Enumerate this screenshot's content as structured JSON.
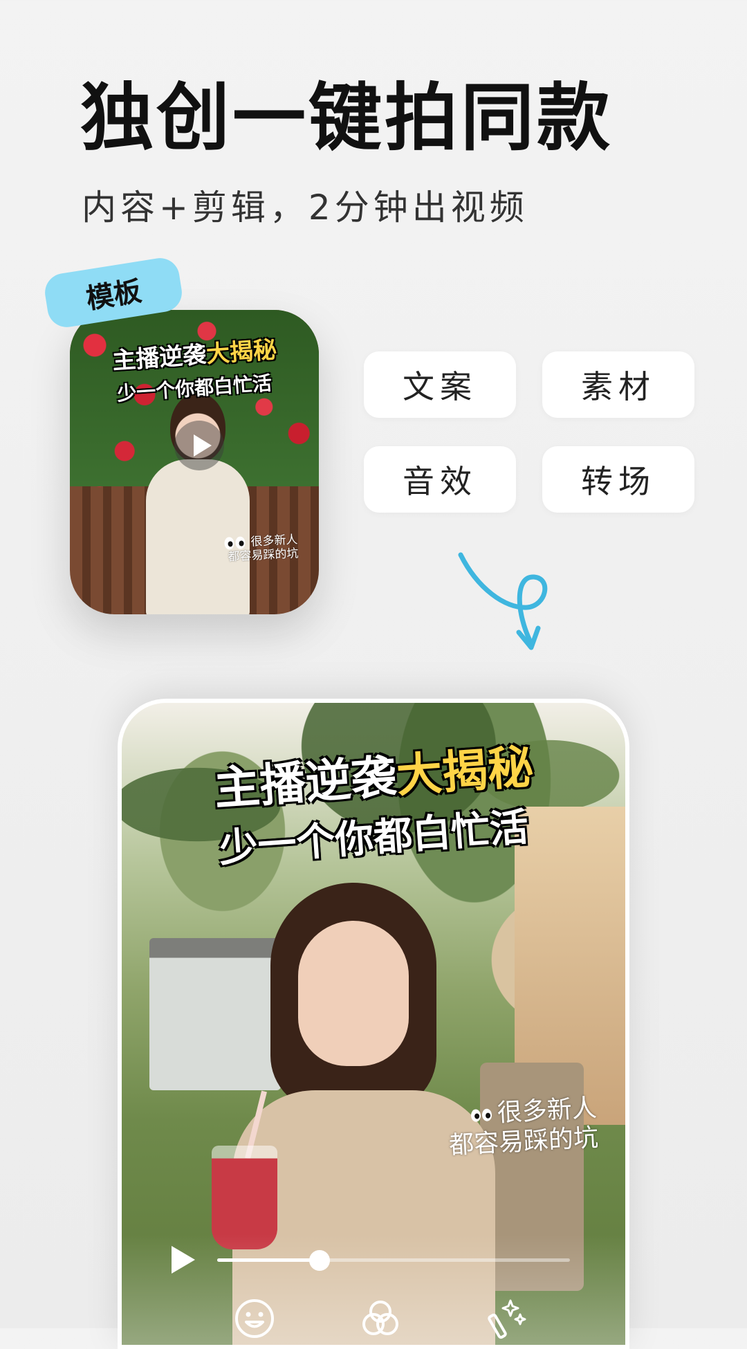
{
  "header": {
    "title": "独创一键拍同款",
    "subtitle": "内容+剪辑，2分钟出视频"
  },
  "template_card": {
    "tag": "模板",
    "title_part1": "主播逆袭",
    "title_highlight": "大揭秘",
    "title_line2": "少一个你都白忙活",
    "caption_line1": "很多新人",
    "caption_line2": "都容易踩的坑",
    "play_icon": "play-icon"
  },
  "features": [
    "文案",
    "素材",
    "音效",
    "转场"
  ],
  "preview": {
    "title_part1": "主播逆袭",
    "title_highlight": "大揭秘",
    "title_line2": "少一个你都白忙活",
    "caption_line1": "很多新人",
    "caption_line2": "都容易踩的坑",
    "progress": 0.29,
    "tools": [
      "sticker-icon",
      "filter-icon",
      "effects-icon"
    ]
  },
  "colors": {
    "accent_blue": "#3fb6df",
    "tag_bg": "#8fdcf5",
    "title_highlight": "#ffd447"
  }
}
